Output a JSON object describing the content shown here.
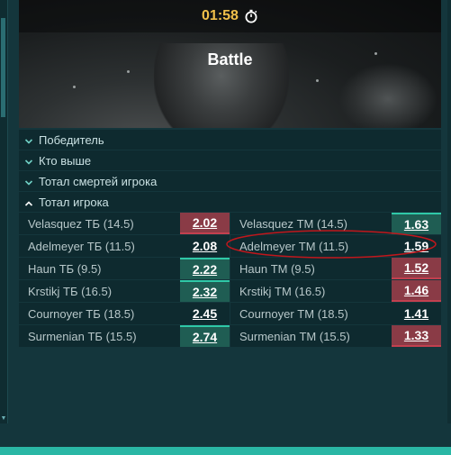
{
  "banner": {
    "timer": "01:58",
    "title": "Battle"
  },
  "sections": [
    {
      "label": "Победитель",
      "expanded": false
    },
    {
      "label": "Кто выше",
      "expanded": false
    },
    {
      "label": "Тотал смертей игрока",
      "expanded": false
    },
    {
      "label": "Тотал игрока",
      "expanded": true
    }
  ],
  "markets": [
    {
      "over_label": "Velasquez ТБ (14.5)",
      "over_odd": "2.02",
      "over_style": "red",
      "under_label": "Velasquez ТМ (14.5)",
      "under_odd": "1.63",
      "under_style": "green"
    },
    {
      "over_label": "Adelmeyer ТБ (11.5)",
      "over_odd": "2.08",
      "over_style": "plain",
      "under_label": "Adelmeyer ТМ (11.5)",
      "under_odd": "1.59",
      "under_style": "plain"
    },
    {
      "over_label": "Haun ТБ (9.5)",
      "over_odd": "2.22",
      "over_style": "green",
      "under_label": "Haun ТМ (9.5)",
      "under_odd": "1.52",
      "under_style": "red"
    },
    {
      "over_label": "Krstikj ТБ (16.5)",
      "over_odd": "2.32",
      "over_style": "green",
      "under_label": "Krstikj ТМ (16.5)",
      "under_odd": "1.46",
      "under_style": "red"
    },
    {
      "over_label": "Cournoyer ТБ (18.5)",
      "over_odd": "2.45",
      "over_style": "plain",
      "under_label": "Cournoyer ТМ (18.5)",
      "under_odd": "1.41",
      "under_style": "plain"
    },
    {
      "over_label": "Surmenian ТБ (15.5)",
      "over_odd": "2.74",
      "over_style": "green",
      "under_label": "Surmenian ТМ (15.5)",
      "under_odd": "1.33",
      "under_style": "red"
    }
  ],
  "colors": {
    "odd_up": "#1f5d53",
    "odd_down": "#8a3b46",
    "annotation": "#c0171c",
    "accent": "#2ab7a5"
  },
  "icons": {
    "timer": "stopwatch-icon",
    "section": "chevron-icon"
  }
}
